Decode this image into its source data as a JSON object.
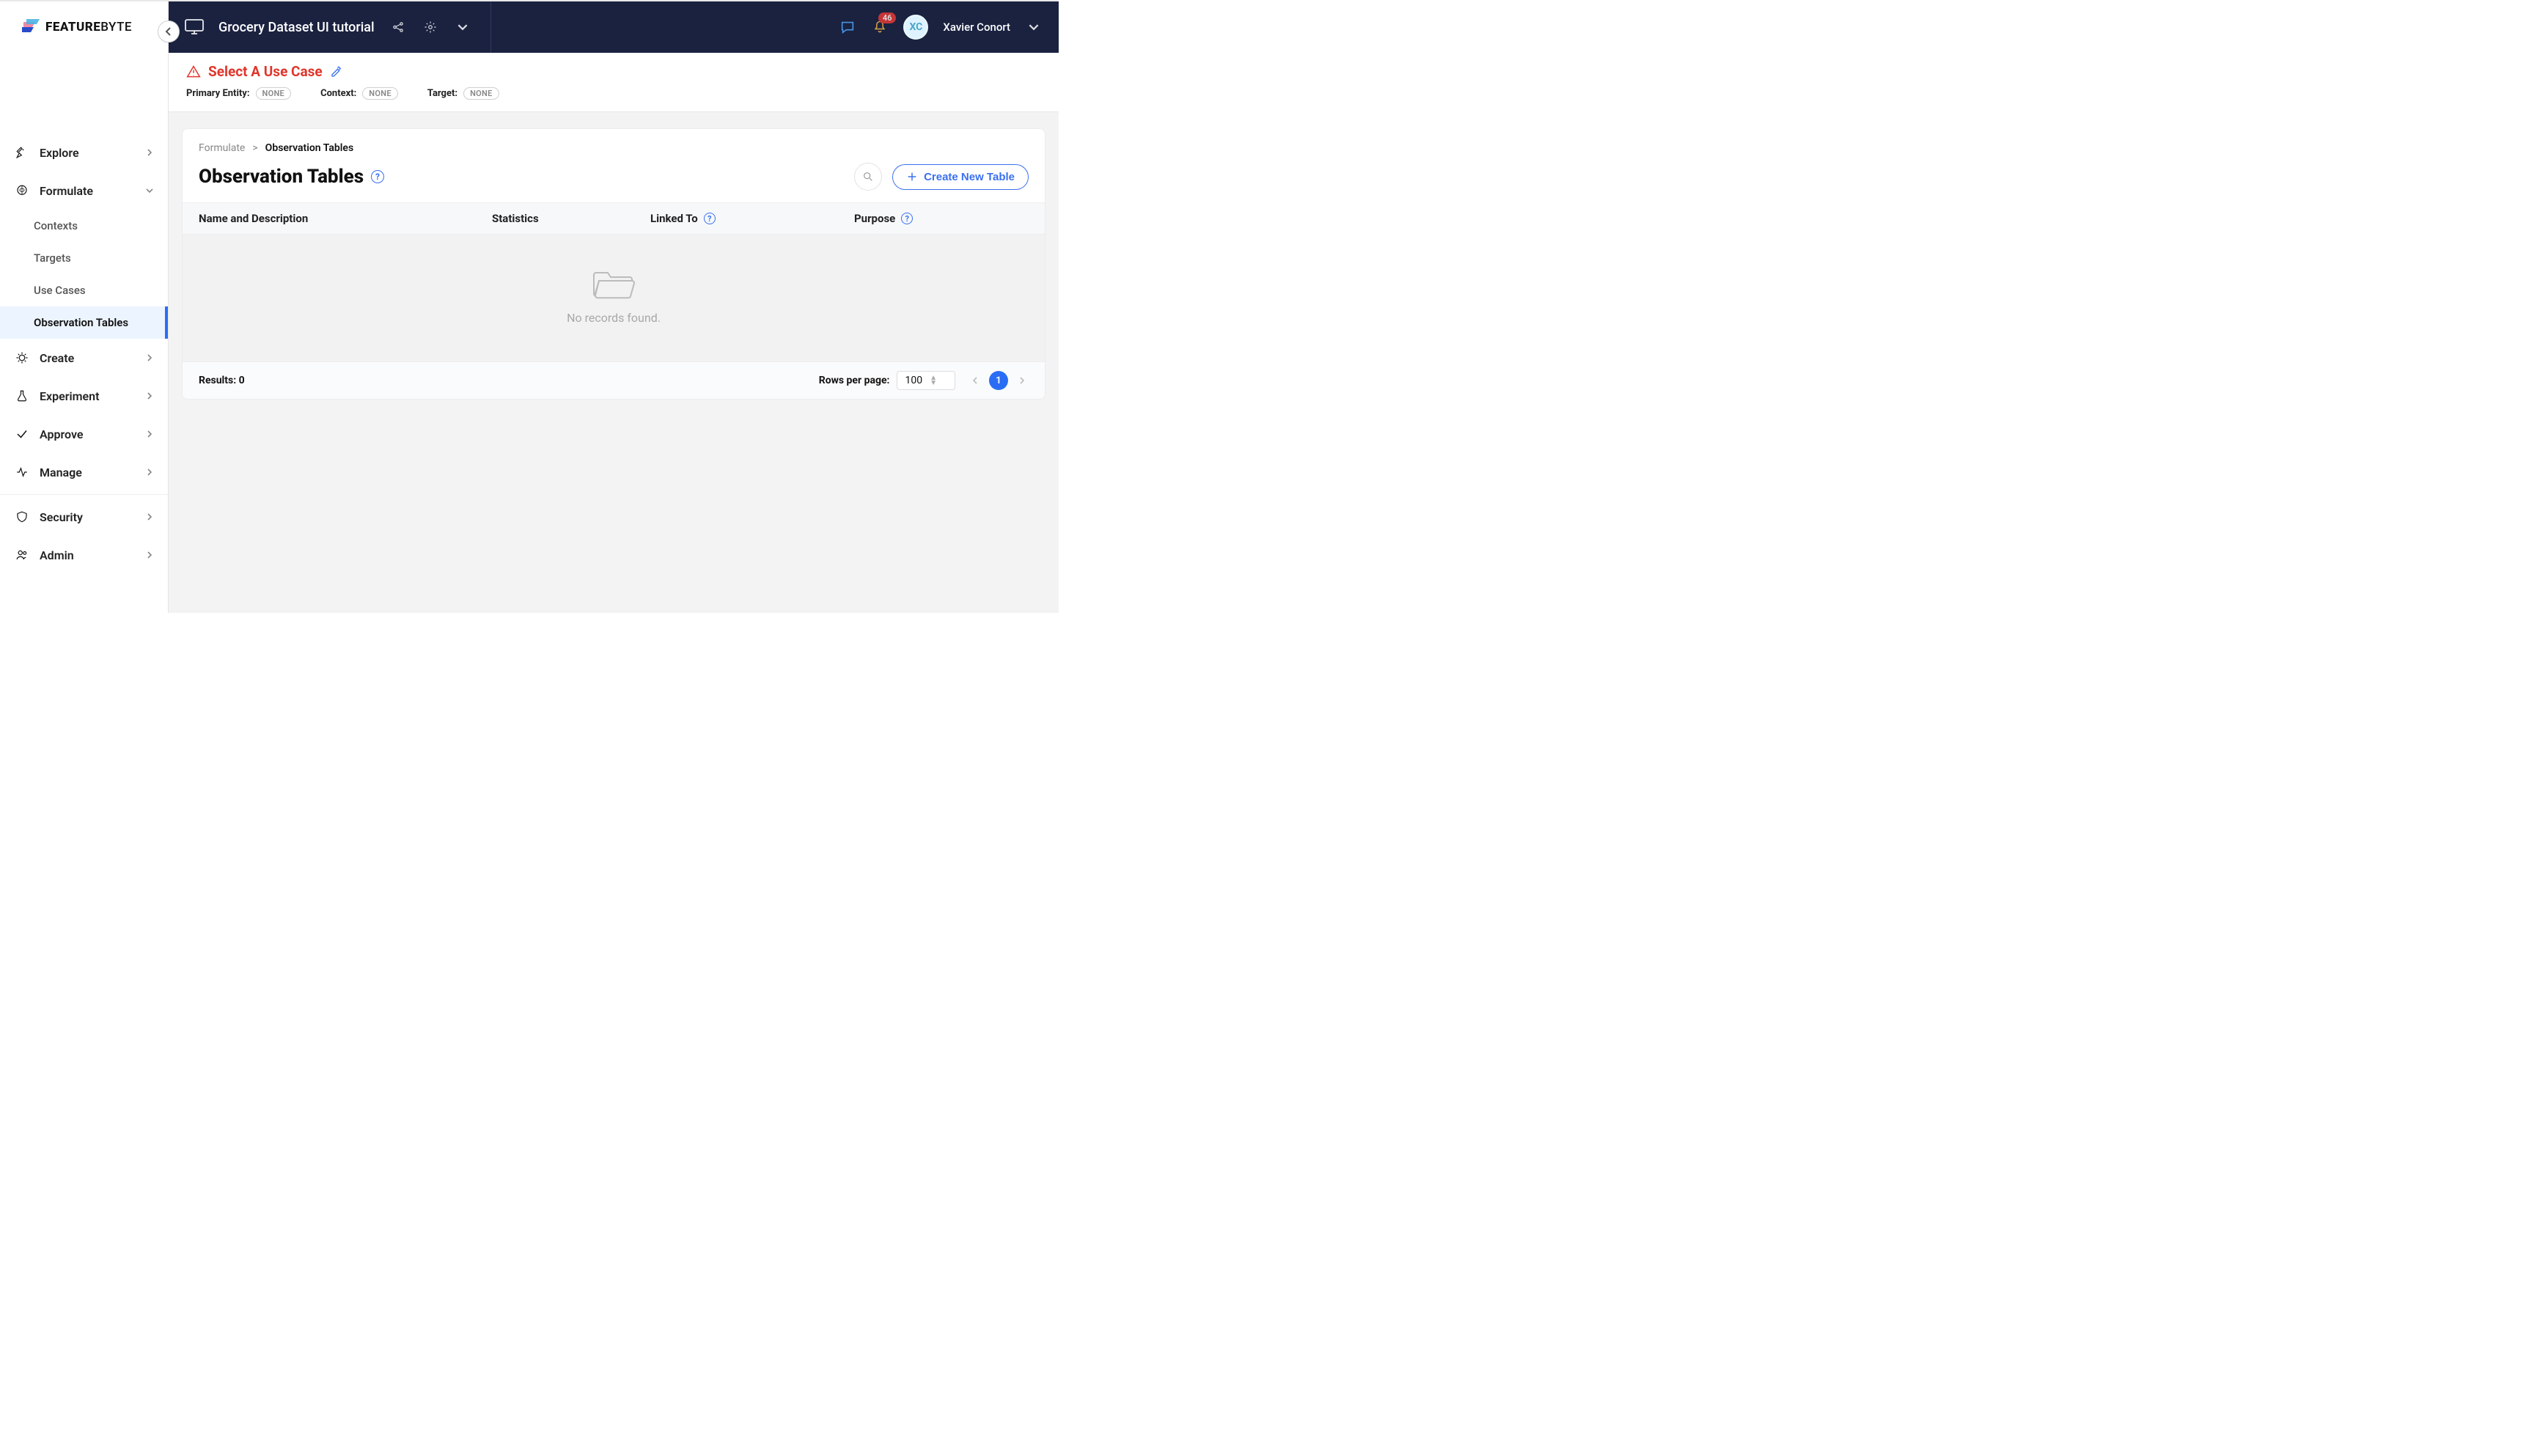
{
  "brand": {
    "name1": "FEATURE",
    "name2": "BYTE"
  },
  "header": {
    "project_title": "Grocery Dataset UI tutorial",
    "notification_count": "46",
    "user_initials": "XC",
    "user_name": "Xavier Conort"
  },
  "sidebar": {
    "items": [
      {
        "label": "Explore"
      },
      {
        "label": "Formulate"
      },
      {
        "label": "Create"
      },
      {
        "label": "Experiment"
      },
      {
        "label": "Approve"
      },
      {
        "label": "Manage"
      },
      {
        "label": "Security"
      },
      {
        "label": "Admin"
      }
    ],
    "formulate_sub": [
      {
        "label": "Contexts"
      },
      {
        "label": "Targets"
      },
      {
        "label": "Use Cases"
      },
      {
        "label": "Observation Tables"
      }
    ]
  },
  "usecase": {
    "title": "Select A Use Case",
    "primary_entity_label": "Primary Entity:",
    "context_label": "Context:",
    "target_label": "Target:",
    "none_chip": "NONE"
  },
  "breadcrumb": {
    "level1": "Formulate",
    "sep": ">",
    "current": "Observation Tables"
  },
  "page": {
    "title": "Observation Tables",
    "create_label": "Create New Table"
  },
  "columns": {
    "name": "Name and Description",
    "stats": "Statistics",
    "linked": "Linked To",
    "purpose": "Purpose"
  },
  "empty": {
    "message": "No records found."
  },
  "footer": {
    "results_label": "Results: 0",
    "rows_label": "Rows per page:",
    "rows_value": "100",
    "page": "1"
  }
}
